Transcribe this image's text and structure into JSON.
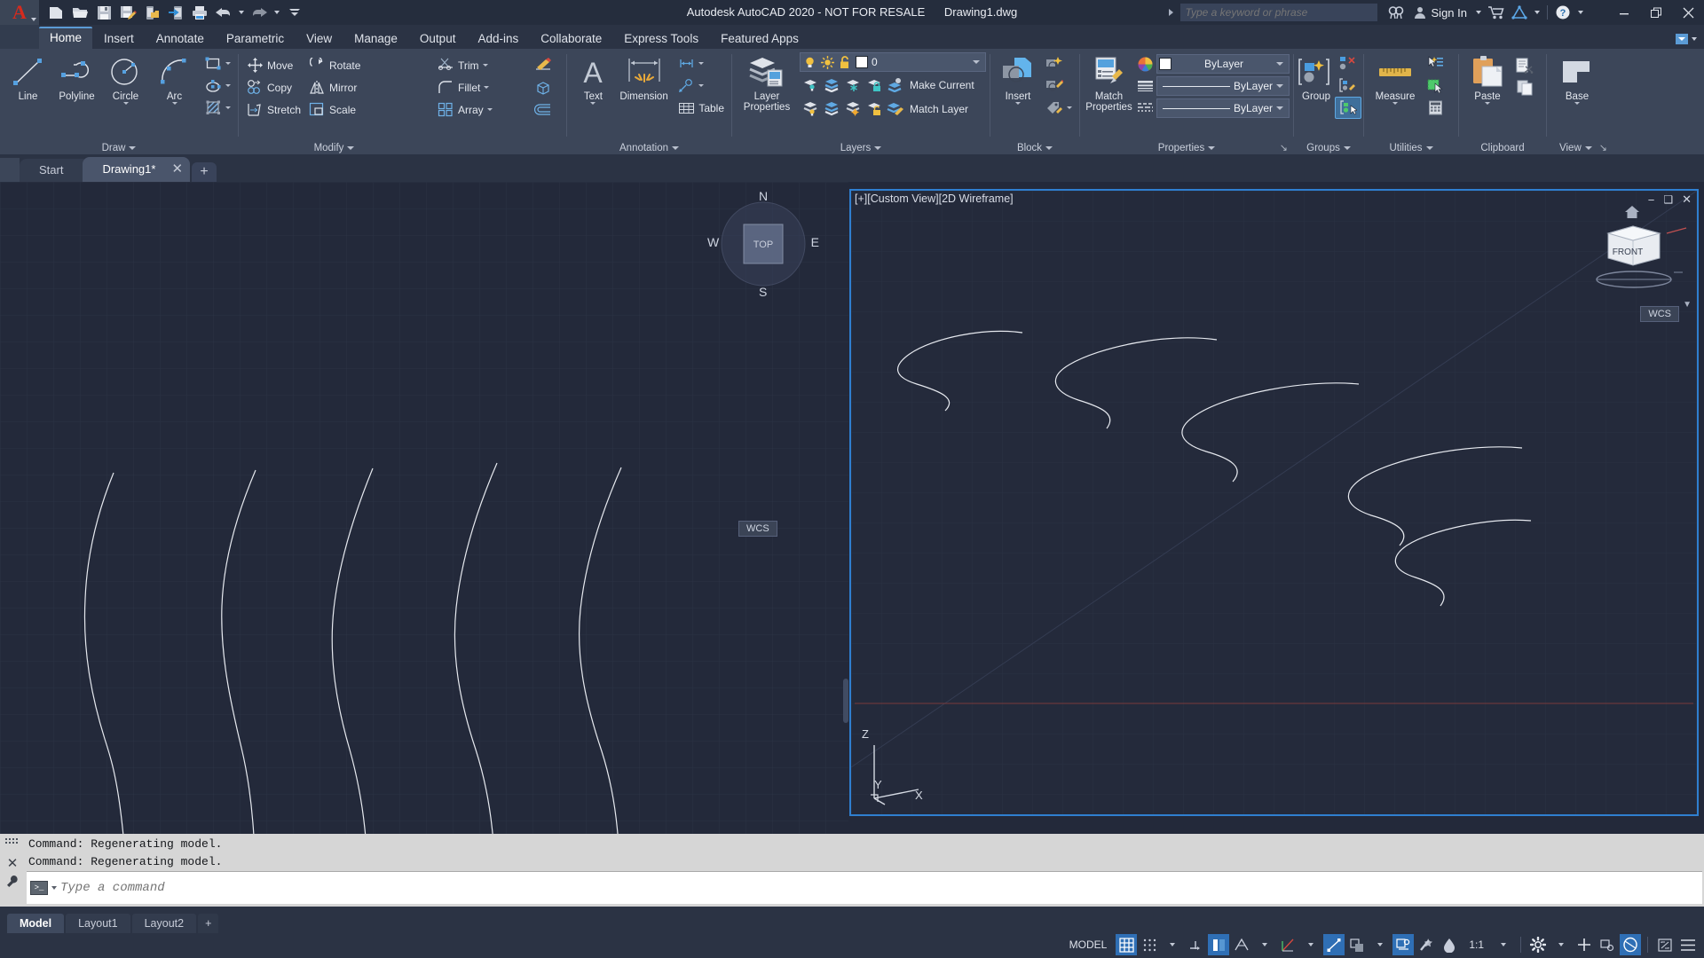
{
  "window": {
    "title": "Autodesk AutoCAD 2020 - NOT FOR RESALE",
    "document": "Drawing1.dwg",
    "minimize": "–",
    "restore": "❐",
    "close": "✕"
  },
  "quick_access": {
    "items": [
      {
        "name": "new-icon",
        "label": "New"
      },
      {
        "name": "open-icon",
        "label": "Open"
      },
      {
        "name": "save-icon",
        "label": "Save"
      },
      {
        "name": "save-as-icon",
        "label": "Save As"
      },
      {
        "name": "save-to-web-mobile-icon",
        "label": "Save to Web & Mobile"
      },
      {
        "name": "open-from-web-mobile-icon",
        "label": "Open from Web & Mobile"
      },
      {
        "name": "plot-icon",
        "label": "Plot"
      },
      {
        "name": "undo-icon",
        "label": "Undo"
      },
      {
        "name": "redo-icon",
        "label": "Redo"
      },
      {
        "name": "customize-qat-icon",
        "label": "Customize Quick Access Toolbar"
      }
    ]
  },
  "infocenter": {
    "placeholder": "Type a keyword or phrase",
    "search_icon": "search-icon",
    "sign_in": "Sign In",
    "user_icon": "user-icon",
    "autodesk_app_store_icon": "cart-icon",
    "autodesk360_icon": "autodesk-a360-icon",
    "help": "?"
  },
  "ribbon": {
    "tabs": [
      {
        "label": "Home",
        "active": true
      },
      {
        "label": "Insert",
        "active": false
      },
      {
        "label": "Annotate",
        "active": false
      },
      {
        "label": "Parametric",
        "active": false
      },
      {
        "label": "View",
        "active": false
      },
      {
        "label": "Manage",
        "active": false
      },
      {
        "label": "Output",
        "active": false
      },
      {
        "label": "Add-ins",
        "active": false
      },
      {
        "label": "Collaborate",
        "active": false
      },
      {
        "label": "Express Tools",
        "active": false
      },
      {
        "label": "Featured Apps",
        "active": false
      }
    ],
    "panels": {
      "draw": {
        "title": "Draw",
        "buttons": [
          {
            "label": "Line",
            "icon": "line-icon"
          },
          {
            "label": "Polyline",
            "icon": "polyline-icon"
          },
          {
            "label": "Circle",
            "icon": "circle-icon",
            "has_dropdown": true
          },
          {
            "label": "Arc",
            "icon": "arc-icon",
            "has_dropdown": true
          }
        ],
        "small_buttons": [
          {
            "label": "Rectangle",
            "icon": "rectangle-icon"
          },
          {
            "label": "Ellipse",
            "icon": "ellipse-icon"
          },
          {
            "label": "Hatch",
            "icon": "hatch-icon"
          }
        ]
      },
      "modify": {
        "title": "Modify",
        "rows": [
          [
            {
              "label": "Move",
              "icon": "move-icon"
            },
            {
              "label": "Rotate",
              "icon": "rotate-icon"
            },
            {
              "label": "Trim",
              "icon": "trim-icon",
              "has_dropdown": true
            },
            {
              "label": "",
              "icon": "erase-icon"
            }
          ],
          [
            {
              "label": "Copy",
              "icon": "copy-icon"
            },
            {
              "label": "Mirror",
              "icon": "mirror-icon"
            },
            {
              "label": "Fillet",
              "icon": "fillet-icon",
              "has_dropdown": true
            },
            {
              "label": "",
              "icon": "explode-icon"
            }
          ],
          [
            {
              "label": "Stretch",
              "icon": "stretch-icon"
            },
            {
              "label": "Scale",
              "icon": "scale-icon"
            },
            {
              "label": "Array",
              "icon": "array-icon",
              "has_dropdown": true
            },
            {
              "label": "",
              "icon": "offset-icon"
            }
          ]
        ]
      },
      "annotation": {
        "title": "Annotation",
        "buttons": [
          {
            "label": "Text",
            "icon": "text-icon",
            "has_dropdown": true
          },
          {
            "label": "Dimension",
            "icon": "dimension-icon"
          }
        ],
        "small_buttons": [
          {
            "label": "",
            "icon": "dimension-linear-icon",
            "has_dropdown": true
          },
          {
            "label": "",
            "icon": "leader-icon",
            "has_dropdown": true
          },
          {
            "label": "Table",
            "icon": "table-icon"
          }
        ]
      },
      "layers": {
        "title": "Layers",
        "big_button": {
          "label_line1": "Layer",
          "label_line2": "Properties",
          "icon": "layer-properties-icon"
        },
        "current_layer": {
          "value": "0",
          "color_swatch": "#ffffff",
          "on_icon": "lightbulb-on-icon",
          "thaw_icon": "sun-icon",
          "unlock_icon": "unlock-icon"
        },
        "row1_icons": [
          "layer-isolate-icon",
          "layer-unisolate-icon",
          "layer-freeze-icon",
          "layer-lock-icon",
          "layer-turn-off-icon"
        ],
        "row2_icons": [
          "layer-off-icon",
          "layer-on-icon",
          "layer-thaw-all-icon",
          "layer-unlock-icon",
          "layer-change-icon"
        ],
        "make_current": "Make Current",
        "match_layer": "Match Layer"
      },
      "block": {
        "title": "Block",
        "big_button": {
          "label": "Insert",
          "icon": "insert-block-icon",
          "has_dropdown": true
        },
        "small_buttons": [
          {
            "icon": "create-block-icon"
          },
          {
            "icon": "edit-block-icon"
          },
          {
            "icon": "edit-attribute-icon",
            "has_dropdown": true
          }
        ]
      },
      "properties": {
        "title": "Properties",
        "big_button": {
          "label_line1": "Match",
          "label_line2": "Properties",
          "icon": "match-properties-icon"
        },
        "rows": [
          {
            "icon": "object-color-icon",
            "swatch": "#ffffff",
            "value": "ByLayer",
            "name": "object-color-combo"
          },
          {
            "icon": "lineweight-icon",
            "value": "ByLayer",
            "name": "lineweight-combo"
          },
          {
            "icon": "linetype-icon",
            "value": "ByLayer",
            "name": "linetype-combo"
          }
        ]
      },
      "groups": {
        "title": "Groups",
        "big_button": {
          "label": "Group",
          "icon": "group-icon"
        },
        "small_buttons": [
          {
            "icon": "ungroup-icon"
          },
          {
            "icon": "group-edit-icon"
          },
          {
            "icon": "group-selection-on-off-icon",
            "active": true
          }
        ]
      },
      "utilities": {
        "title": "Utilities",
        "big_button": {
          "label": "Measure",
          "icon": "measure-icon",
          "has_dropdown": true
        },
        "small_buttons": [
          {
            "icon": "quick-select-icon"
          },
          {
            "icon": "select-all-icon"
          },
          {
            "icon": "calculator-icon"
          }
        ]
      },
      "clipboard": {
        "title": "Clipboard",
        "big_button": {
          "label": "Paste",
          "icon": "paste-icon",
          "has_dropdown": true
        },
        "small_buttons": [
          {
            "icon": "cut-icon"
          },
          {
            "icon": "copy-clip-icon"
          }
        ]
      },
      "view": {
        "title": "View",
        "big_button": {
          "label": "Base",
          "icon": "base-view-icon",
          "has_dropdown": true
        }
      }
    }
  },
  "file_tabs": {
    "tabs": [
      {
        "label": "Start",
        "active": false,
        "closable": false
      },
      {
        "label": "Drawing1*",
        "active": true,
        "closable": true
      }
    ],
    "new_tab": "+"
  },
  "viewports": {
    "left": {
      "name": "left-viewport",
      "view_label": "",
      "viewcube": {
        "top": "TOP",
        "north": "N",
        "south": "S",
        "east": "E",
        "west": "W",
        "wcs": "WCS"
      }
    },
    "right": {
      "name": "right-viewport",
      "view_label": "[+][Custom View][2D Wireframe]",
      "controls": {
        "minimize": "–",
        "maximize": "❐",
        "close": "✕"
      },
      "viewcube": {
        "front": "FRONT",
        "wcs": "WCS"
      },
      "ucs_axes": {
        "x": "X",
        "y": "Y",
        "z": "Z"
      },
      "home_icon": "home-icon"
    }
  },
  "command_line": {
    "history": [
      "Command:  Regenerating model.",
      "Command:  Regenerating model."
    ],
    "placeholder": "Type a command",
    "close_icon": "close-icon",
    "settings_icon": "wrench-icon",
    "grip_icon": "grip-icon"
  },
  "status_bar": {
    "layout_tabs": [
      {
        "label": "Model",
        "active": true
      },
      {
        "label": "Layout1",
        "active": false
      },
      {
        "label": "Layout2",
        "active": false
      }
    ],
    "new_layout": "+",
    "model_label": "MODEL",
    "scale": "1:1",
    "toggles": [
      {
        "name": "grid-display-toggle",
        "icon": "grid-icon",
        "on": true
      },
      {
        "name": "snap-mode-toggle",
        "icon": "snap-icon",
        "on": false,
        "has_dropdown": true
      },
      {
        "name": "infer-constraints-toggle",
        "icon": "infer-constraints-icon",
        "on": false
      },
      {
        "name": "dynamic-input-toggle",
        "icon": "dynamic-input-icon",
        "on": true
      },
      {
        "name": "ortho-mode-toggle",
        "icon": "ortho-icon",
        "on": false
      },
      {
        "name": "polar-tracking-toggle",
        "icon": "polar-tracking-icon",
        "on": false,
        "has_dropdown": true
      },
      {
        "name": "isometric-drafting-toggle",
        "icon": "isometric-icon",
        "on": false,
        "has_dropdown": true
      },
      {
        "name": "object-snap-tracking-toggle",
        "icon": "osnap-tracking-icon",
        "on": true
      },
      {
        "name": "object-snap-toggle",
        "icon": "object-snap-icon",
        "on": false,
        "has_dropdown": true
      },
      {
        "name": "lineweight-toggle",
        "icon": "show-lineweight-icon",
        "on": false
      },
      {
        "name": "transparency-toggle",
        "icon": "transparency-icon",
        "on": true
      },
      {
        "name": "selection-cycling-toggle",
        "icon": "selection-cycling-icon",
        "on": false
      },
      {
        "name": "3d-object-snap-toggle",
        "icon": "3d-osnap-icon",
        "on": false
      },
      {
        "name": "dynamic-ucs-toggle",
        "icon": "dynamic-ucs-icon",
        "on": false
      }
    ],
    "right_icons": [
      {
        "name": "annotation-scale-dropdown",
        "label": "1:1"
      },
      {
        "name": "workspace-switching-icon",
        "icon": "gear-icon",
        "has_dropdown": true
      },
      {
        "name": "annotation-monitor-icon",
        "icon": "plus-icon"
      },
      {
        "name": "units-icon",
        "icon": "units-icon"
      },
      {
        "name": "isolate-objects-icon",
        "icon": "isolate-objects-icon",
        "on": true
      },
      {
        "name": "fullscreen-icon",
        "icon": "fullscreen-icon"
      },
      {
        "name": "customization-icon",
        "icon": "hamburger-icon"
      }
    ]
  }
}
